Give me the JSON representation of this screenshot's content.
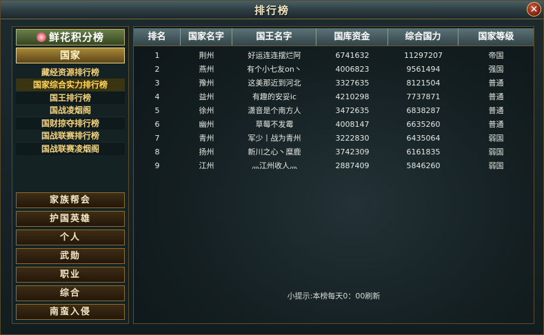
{
  "title": "排行榜",
  "close_label": "✕",
  "sidebar": {
    "flower_tab": "鲜花积分榜",
    "active_category": "国家",
    "sub_items": [
      {
        "label": "藏经资源排行榜"
      },
      {
        "label": "国家综合实力排行榜"
      },
      {
        "label": "国王排行榜"
      },
      {
        "label": "国战凌烟阁"
      },
      {
        "label": "国财掠夺排行榜"
      },
      {
        "label": "国战联赛排行榜"
      },
      {
        "label": "国战联赛凌烟阁"
      }
    ],
    "categories": [
      {
        "label": "家族帮会"
      },
      {
        "label": "护国英雄"
      },
      {
        "label": "个人"
      },
      {
        "label": "武勋"
      },
      {
        "label": "职业"
      },
      {
        "label": "综合"
      },
      {
        "label": "南蛮入侵"
      }
    ]
  },
  "table": {
    "headers": [
      "排名",
      "国家名字",
      "国王名字",
      "国库资金",
      "综合国力",
      "国家等级"
    ],
    "rows": [
      [
        "1",
        "荆州",
        "好运连连摆烂阿",
        "6741632",
        "11297207",
        "帝国"
      ],
      [
        "2",
        "燕州",
        "有个小七友on丶",
        "4006823",
        "9561494",
        "强国"
      ],
      [
        "3",
        "豫州",
        "这美那近到河北",
        "3327635",
        "8121504",
        "普通"
      ],
      [
        "4",
        "益州",
        "有趣的安妥ic",
        "4210298",
        "7737871",
        "普通"
      ],
      [
        "5",
        "徐州",
        "潇音是个南方人",
        "3472635",
        "6838287",
        "普通"
      ],
      [
        "6",
        "幽州",
        "草莓不发霉",
        "4008147",
        "6635260",
        "普通"
      ],
      [
        "7",
        "青州",
        "军少丨战为青州",
        "3222830",
        "6435064",
        "弱国"
      ],
      [
        "8",
        "扬州",
        "新川之心丶糜鹿",
        "3742309",
        "6161835",
        "弱国"
      ],
      [
        "9",
        "江州",
        "灬江州收人灬",
        "2887409",
        "5846260",
        "弱国"
      ]
    ]
  },
  "hint": "小提示:本榜每天0：00刷新"
}
